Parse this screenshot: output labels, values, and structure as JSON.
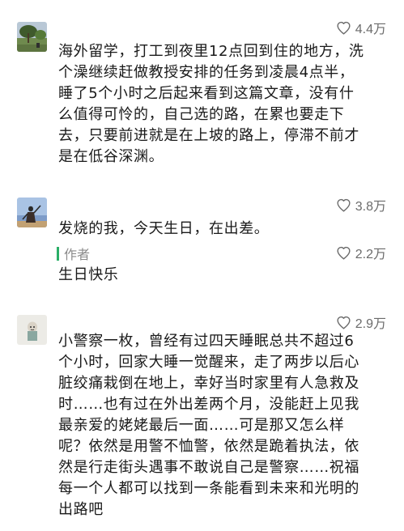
{
  "comments": [
    {
      "likes": "4.4万",
      "avatar_icon": "landscape-photo",
      "lines": [
        "海外留学，打工到夜里12点回到住的地方，洗",
        "个澡继续赶做教授安排的任务到凌晨4点半，",
        "睡了5个小时之后起来看到这篇文章，没有什",
        "么值得可怜的，自己选的路，在累也要走下",
        "去，只要前进就是在上坡的路上，停滞不前才",
        "是在低谷深渊。"
      ]
    },
    {
      "likes": "3.8万",
      "avatar_icon": "figure-photo",
      "lines": [
        "发烧的我，今天生日，在出差。"
      ],
      "reply": {
        "author_label": "作者",
        "likes": "2.2万",
        "text": "生日快乐"
      }
    },
    {
      "likes": "2.9万",
      "avatar_icon": "cartoon-photo",
      "lines": [
        "小警察一枚，曾经有过四天睡眠总共不超过6",
        "个小时，回家大睡一觉醒来，走了两步以后心",
        "脏绞痛栽倒在地上，幸好当时家里有人急救及",
        "时……也有过在外出差两个月，没能赶上见我",
        "最亲爱的姥姥最后一面……可是那又怎么样",
        "呢？依然是用警不恤警，依然是跪着执法，依",
        "然是行走街头遇事不敢说自己是警察……祝福",
        "每一个人都可以找到一条能看到未来和光明的",
        "出路吧"
      ]
    }
  ],
  "colors": {
    "author_bar": "#2aae67",
    "like_text": "#6b6b6b",
    "body_text": "#1a1a1a"
  }
}
